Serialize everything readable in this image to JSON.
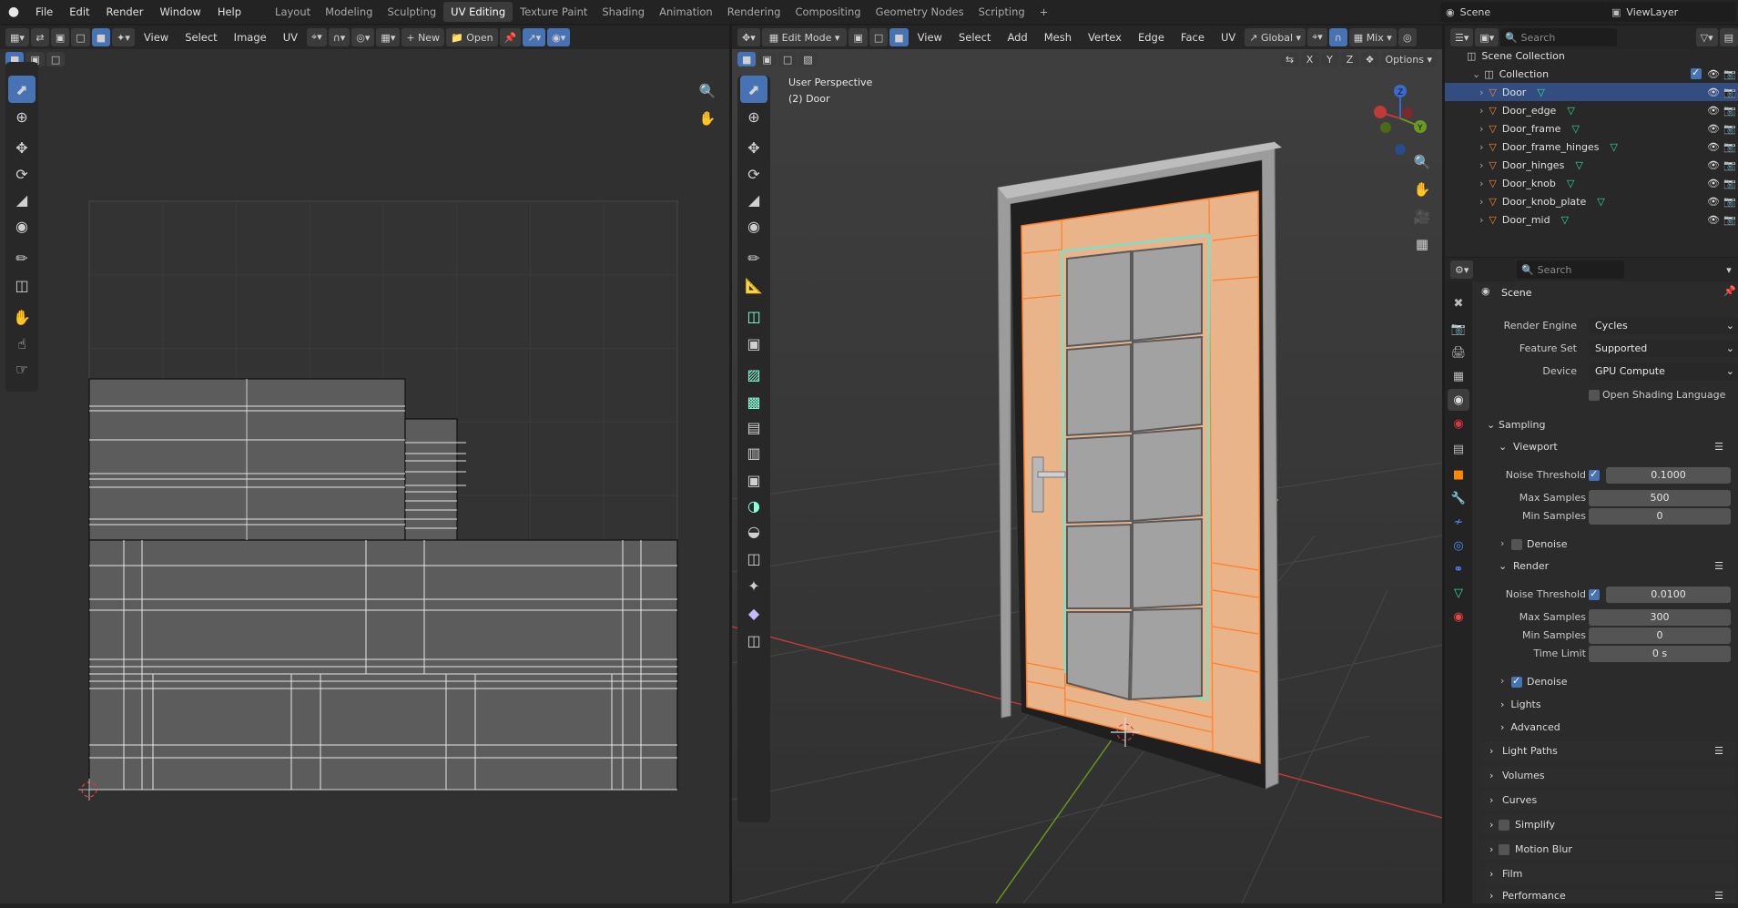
{
  "topbar": {
    "menus": [
      "File",
      "Edit",
      "Render",
      "Window",
      "Help"
    ],
    "workspaces": [
      "Layout",
      "Modeling",
      "Sculpting",
      "UV Editing",
      "Texture Paint",
      "Shading",
      "Animation",
      "Rendering",
      "Compositing",
      "Geometry Nodes",
      "Scripting"
    ],
    "active_workspace": "UV Editing",
    "add_tab": "+",
    "scene_label": "Scene",
    "viewlayer_label": "ViewLayer"
  },
  "uv_editor": {
    "menus": [
      "View",
      "Select",
      "Image",
      "UV"
    ],
    "new_label": "New",
    "open_label": "Open"
  },
  "viewport": {
    "mode": "Edit Mode",
    "menus": [
      "View",
      "Select",
      "Add",
      "Mesh",
      "Vertex",
      "Edge",
      "Face",
      "UV"
    ],
    "transform_orientation": "Global",
    "proportional": "Mix",
    "axes": [
      "X",
      "Y",
      "Z"
    ],
    "options_label": "Options",
    "view_name": "User Perspective",
    "object_name": "(2) Door"
  },
  "outliner": {
    "search_placeholder": "Search",
    "scene_collection": "Scene Collection",
    "collection": "Collection",
    "objects": [
      "Door",
      "Door_edge",
      "Door_frame",
      "Door_frame_hinges",
      "Door_hinges",
      "Door_knob",
      "Door_knob_plate",
      "Door_mid"
    ],
    "selected_object": "Door"
  },
  "properties": {
    "search_placeholder": "Search",
    "context_title": "Scene",
    "render_engine_label": "Render Engine",
    "render_engine": "Cycles",
    "feature_set_label": "Feature Set",
    "feature_set": "Supported",
    "device_label": "Device",
    "device": "GPU Compute",
    "osl_label": "Open Shading Language",
    "sampling_label": "Sampling",
    "viewport_label": "Viewport",
    "noise_threshold_label": "Noise Threshold",
    "viewport_noise_threshold": "0.1000",
    "max_samples_label": "Max Samples",
    "viewport_max_samples": "500",
    "min_samples_label": "Min Samples",
    "viewport_min_samples": "0",
    "denoise_label": "Denoise",
    "render_label": "Render",
    "render_noise_threshold": "0.0100",
    "render_max_samples": "300",
    "render_min_samples": "0",
    "time_limit_label": "Time Limit",
    "time_limit": "0 s",
    "lights_label": "Lights",
    "advanced_label": "Advanced",
    "light_paths_label": "Light Paths",
    "volumes_label": "Volumes",
    "curves_label": "Curves",
    "simplify_label": "Simplify",
    "motion_blur_label": "Motion Blur",
    "film_label": "Film",
    "performance_label": "Performance"
  },
  "colors": {
    "accent": "#4772b3",
    "selection_orange": "#ff7f2a",
    "door_face": "#e9b48a",
    "glass_edge": "#7fe0c8",
    "x_axis": "#c03a3a",
    "y_axis": "#6a9a1f"
  }
}
